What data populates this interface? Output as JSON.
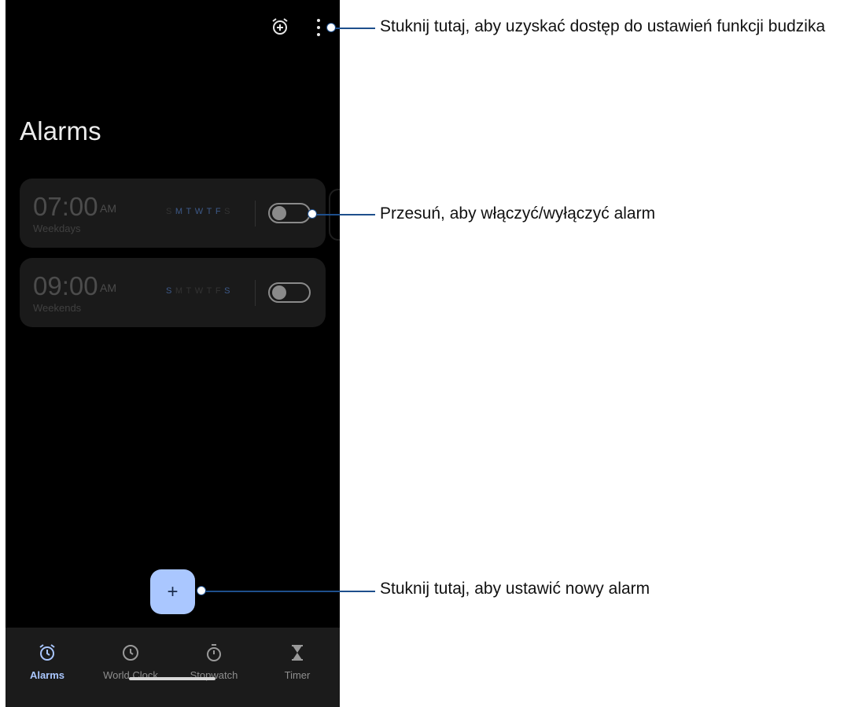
{
  "screen": {
    "title": "Alarms",
    "topbar": {
      "left_icon": "alarm-add-icon",
      "right_icon": "more-vert-icon"
    },
    "alarms": [
      {
        "time": "07:00",
        "ampm": "AM",
        "subtitle": "Weekdays",
        "days": [
          {
            "label": "S",
            "active": false
          },
          {
            "label": "M",
            "active": true
          },
          {
            "label": "T",
            "active": true
          },
          {
            "label": "W",
            "active": true
          },
          {
            "label": "T",
            "active": true
          },
          {
            "label": "F",
            "active": true
          },
          {
            "label": "S",
            "active": false
          }
        ],
        "enabled": false
      },
      {
        "time": "09:00",
        "ampm": "AM",
        "subtitle": "Weekends",
        "days": [
          {
            "label": "S",
            "active": true
          },
          {
            "label": "M",
            "active": false
          },
          {
            "label": "T",
            "active": false
          },
          {
            "label": "W",
            "active": false
          },
          {
            "label": "T",
            "active": false
          },
          {
            "label": "F",
            "active": false
          },
          {
            "label": "S",
            "active": true
          }
        ],
        "enabled": false
      }
    ],
    "fab_label": "+",
    "bottom_nav": [
      {
        "label": "Alarms",
        "icon": "alarm-icon",
        "active": true
      },
      {
        "label": "World Clock",
        "icon": "clock-icon",
        "active": false
      },
      {
        "label": "Stopwatch",
        "icon": "stopwatch-icon",
        "active": false
      },
      {
        "label": "Timer",
        "icon": "hourglass-icon",
        "active": false
      }
    ]
  },
  "callouts": {
    "settings": "Stuknij tutaj, aby uzyskać dostęp do ustawień funkcji budzika",
    "toggle": "Przesuń, aby włączyć/wyłączyć alarm",
    "add": "Stuknij tutaj, aby ustawić nowy alarm"
  },
  "colors": {
    "accent": "#aac7ff",
    "callout": "#1e4f8c",
    "background": "#000000"
  }
}
